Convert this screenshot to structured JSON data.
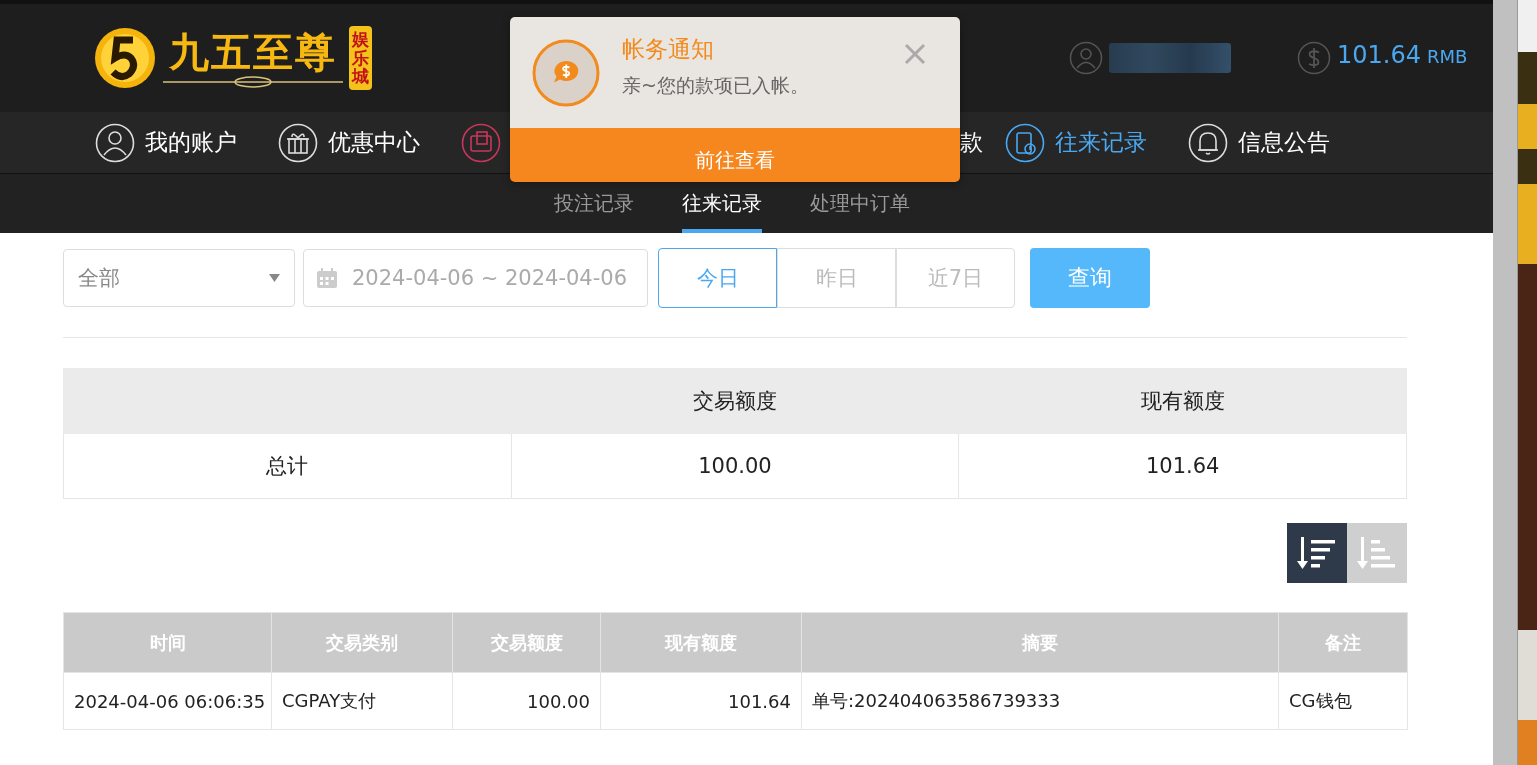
{
  "header": {
    "logo": {
      "name": "九五至尊",
      "badge": "娱乐城"
    },
    "balance": {
      "amount": "101.64",
      "currency": "RMB"
    }
  },
  "nav": [
    {
      "label": "我的账户",
      "selected": false,
      "highlighted": false
    },
    {
      "label": "优惠中心",
      "selected": false,
      "highlighted": false
    },
    {
      "selected": false,
      "highlighted": true
    },
    {
      "label": "款",
      "selected": false,
      "highlighted": false
    },
    {
      "label": "往来记录",
      "selected": true,
      "highlighted": false
    },
    {
      "label": "信息公告",
      "selected": false,
      "highlighted": false
    }
  ],
  "subnav": [
    {
      "label": "投注记录",
      "selected": false
    },
    {
      "label": "往来记录",
      "selected": true
    },
    {
      "label": "处理中订单",
      "selected": false
    }
  ],
  "notification": {
    "title": "帐务通知",
    "message": "亲~您的款项已入帐。",
    "action": "前往查看"
  },
  "filters": {
    "type": "全部",
    "date_range": "2024-04-06 ~ 2024-04-06",
    "quick": [
      {
        "label": "今日",
        "selected": true
      },
      {
        "label": "昨日",
        "selected": false
      },
      {
        "label": "近7日",
        "selected": false
      }
    ],
    "query": "查询"
  },
  "summary": {
    "columns": [
      "",
      "交易额度",
      "现有额度"
    ],
    "rows": [
      [
        "总计",
        "100.00",
        "101.64"
      ]
    ]
  },
  "sort": [
    {
      "selected": true
    },
    {
      "selected": false
    }
  ],
  "table": {
    "columns": [
      "时间",
      "交易类别",
      "交易额度",
      "现有额度",
      "摘要",
      "备注"
    ],
    "rows": [
      [
        "2024-04-06 06:06:35",
        "CGPAY支付",
        "100.00",
        "101.64",
        "单号:202404063586739333",
        "CG钱包"
      ]
    ]
  }
}
